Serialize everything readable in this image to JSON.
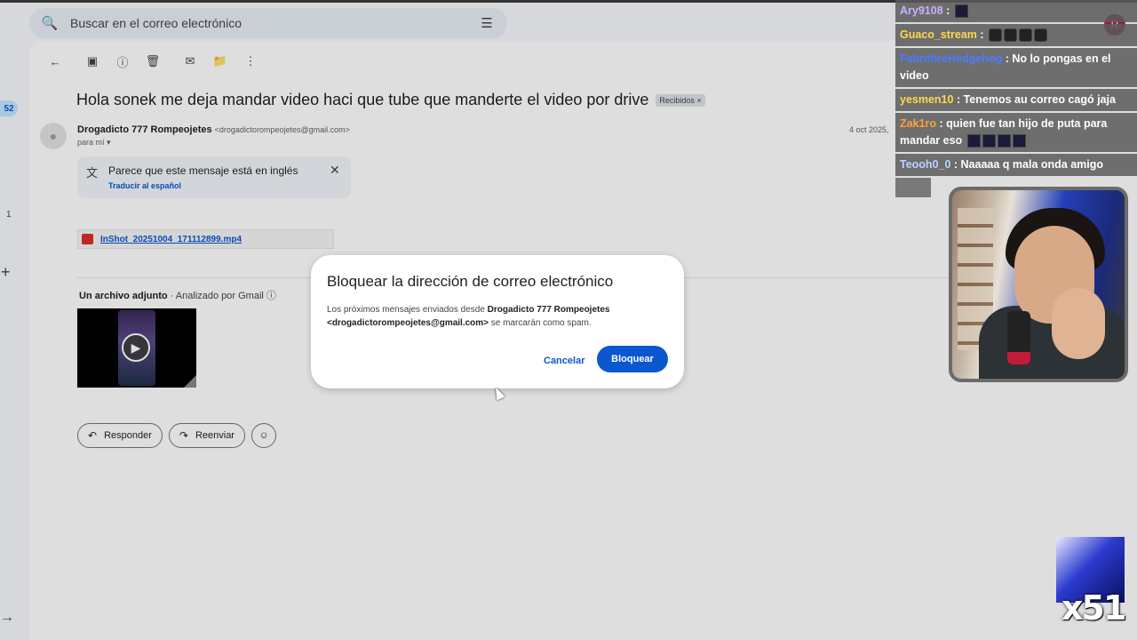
{
  "search": {
    "placeholder": "Buscar en el correo electrónico"
  },
  "rail": {
    "badge": "52",
    "num": "1"
  },
  "email": {
    "subject": "Hola sonek me deja mandar video haci que tube que manderte el video por drive",
    "label_chip": "Recibidos",
    "sender_name": "Drogadicto 777 Rompeojetes",
    "sender_email": "<drogadictorompeojetes@gmail.com>",
    "to_me": "para mí",
    "date": "4 oct 2025,"
  },
  "translate": {
    "message": "Parece que este mensaje está en inglés",
    "link": "Traducir al español"
  },
  "attachment": {
    "filename": "InShot_20251004_171112899.mp4",
    "header_count": "Un archivo adjunto",
    "header_scan": "Analizado por Gmail"
  },
  "actions": {
    "reply": "Responder",
    "forward": "Reenviar"
  },
  "dialog": {
    "title": "Bloquear la dirección de correo electrónico",
    "body_prefix": "Los próximos mensajes enviados desde ",
    "body_sender": "Drogadicto 777 Rompeojetes <drogadictorompeojetes@gmail.com>",
    "body_suffix": " se marcarán como spam.",
    "cancel": "Cancelar",
    "confirm": "Bloquear"
  },
  "chat": [
    {
      "user": "Ary9108",
      "text": "",
      "color": "#c8b0ff"
    },
    {
      "user": "Guaco_stream",
      "text": "",
      "color": "#ffd84a"
    },
    {
      "user": "FabrithreHedgehog",
      "text": "No lo pongas en el video",
      "color": "#4b7bff"
    },
    {
      "user": "yesmen10",
      "text": "Tenemos au correo cagó jaja",
      "color": "#ffd84a"
    },
    {
      "user": "Zak1ro",
      "text": "quien fue tan hijo de puta para mandar eso",
      "color": "#ffa13a"
    },
    {
      "user": "Teooh0_0",
      "text": "Naaaaa q mala onda amigo",
      "color": "#b8d4ff"
    }
  ],
  "gmail_avatar": "R",
  "overlay_counter": "x51"
}
